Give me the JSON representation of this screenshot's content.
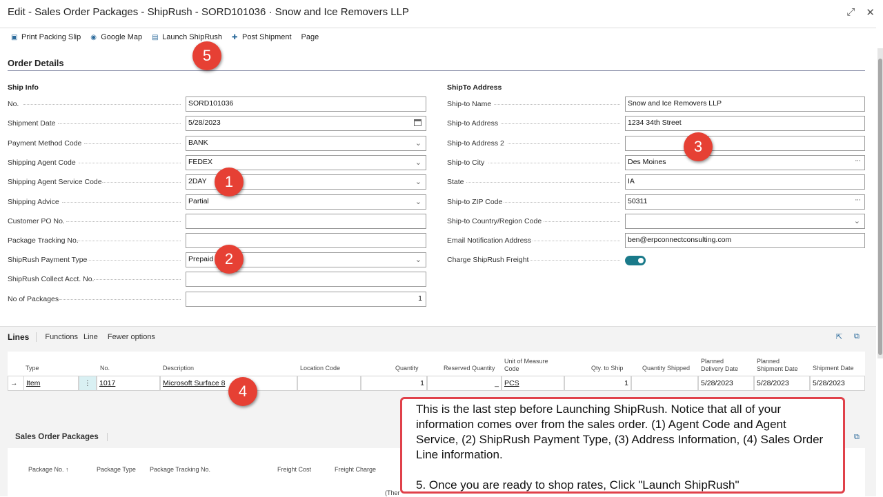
{
  "window": {
    "title": "Edit - Sales Order Packages - ShipRush - SORD101036 · Snow and Ice Removers LLP"
  },
  "toolbar": {
    "items": [
      "Print Packing Slip",
      "Google Map",
      "Launch ShipRush",
      "Post Shipment",
      "Page"
    ]
  },
  "order_details": {
    "title": "Order Details"
  },
  "ship_info": {
    "title": "Ship Info",
    "fields": [
      {
        "label": "No.",
        "value": "SORD101036"
      },
      {
        "label": "Shipment Date",
        "value": "5/28/2023"
      },
      {
        "label": "Payment Method Code",
        "value": "BANK"
      },
      {
        "label": "Shipping Agent Code",
        "value": "FEDEX"
      },
      {
        "label": "Shipping Agent Service Code",
        "value": "2DAY"
      },
      {
        "label": "Shipping Advice",
        "value": "Partial"
      },
      {
        "label": "Customer PO No.",
        "value": ""
      },
      {
        "label": "Package Tracking No.",
        "value": ""
      },
      {
        "label": "ShipRush Payment Type",
        "value": "Prepaid"
      },
      {
        "label": "ShipRush Collect Acct. No.",
        "value": ""
      },
      {
        "label": "No of Packages",
        "value": "1"
      }
    ]
  },
  "ship_to": {
    "title": "ShipTo Address",
    "fields": [
      {
        "label": "Ship-to Name",
        "value": "Snow and Ice Removers LLP"
      },
      {
        "label": "Ship-to Address",
        "value": "1234 34th Street"
      },
      {
        "label": "Ship-to Address 2",
        "value": ""
      },
      {
        "label": "Ship-to City",
        "value": "Des Moines"
      },
      {
        "label": "State",
        "value": "IA"
      },
      {
        "label": "Ship-to ZIP Code",
        "value": "50311"
      },
      {
        "label": "Ship-to Country/Region Code",
        "value": ""
      },
      {
        "label": "Email Notification Address",
        "value": "ben@erpconnectconsulting.com"
      },
      {
        "label": "Charge ShipRush Freight",
        "value": ""
      }
    ]
  },
  "lines": {
    "title": "Lines",
    "menu": [
      "Functions",
      "Line",
      "Fewer options"
    ],
    "columns": [
      "Type",
      "No.",
      "Description",
      "Location Code",
      "Quantity",
      "Reserved Quantity",
      "Unit of Measure Code",
      "Qty. to Ship",
      "Quantity Shipped",
      "Planned Delivery Date",
      "Planned Shipment Date",
      "Shipment Date"
    ],
    "row": [
      "Item",
      "1017",
      "Microsoft Surface 8",
      "",
      "1",
      "_",
      "PCS",
      "1",
      "",
      "5/28/2023",
      "5/28/2023",
      "5/28/2023"
    ]
  },
  "packages": {
    "title": "Sales Order Packages",
    "columns": [
      "Package No. ↑",
      "Package Type",
      "Package Tracking No.",
      "Freight Cost",
      "Freight Charge"
    ],
    "partial_text": "(Ther"
  },
  "badges": [
    "1",
    "2",
    "3",
    "4",
    "5"
  ],
  "callout": {
    "text1": "This is the last step before Launching ShipRush. Notice that all of your information comes over from the sales order. (1) Agent Code and Agent Service, (2) ShipRush Payment Type, (3) Address Information, (4) Sales Order Line information.",
    "text2": "5. Once you are ready to shop rates, Click \"Launch ShipRush\""
  },
  "colors": {
    "accent": "#1a7a8a",
    "badge": "#e64034",
    "callout_border": "#e0414a"
  }
}
